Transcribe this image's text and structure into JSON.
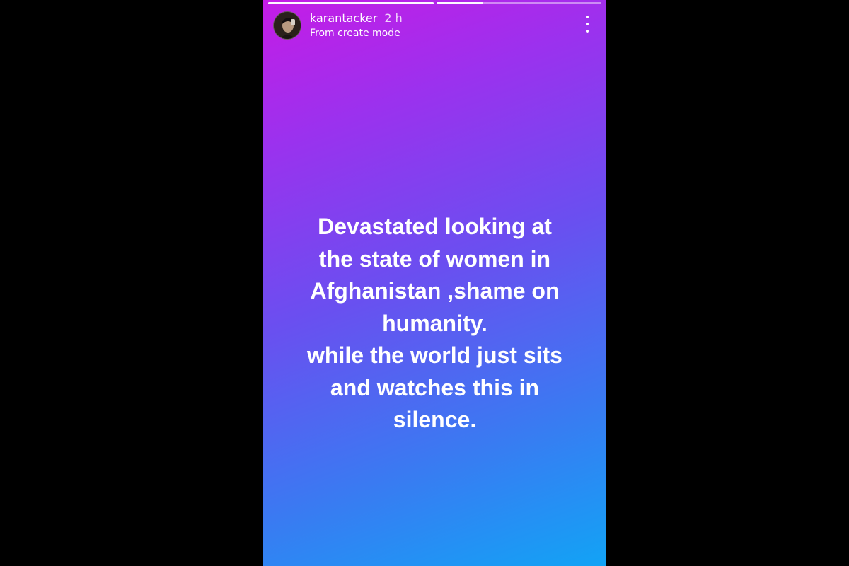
{
  "story": {
    "username": "karantacker",
    "time_ago": "2 h",
    "subtitle": "From create mode",
    "progress": [
      1,
      0.28
    ],
    "caption_lines": [
      "Devastated looking at",
      "the state of women in",
      "Afghanistan ,shame on",
      "humanity.",
      "while the world just sits",
      "and watches this in",
      "silence."
    ],
    "icons": {
      "avatar": "profile-photo",
      "menu": "more-vertical-icon"
    },
    "colors": {
      "gradient_top": "#c51ce6",
      "gradient_bottom": "#12a3f5",
      "text": "#ffffff",
      "letterbox": "#000000"
    }
  }
}
